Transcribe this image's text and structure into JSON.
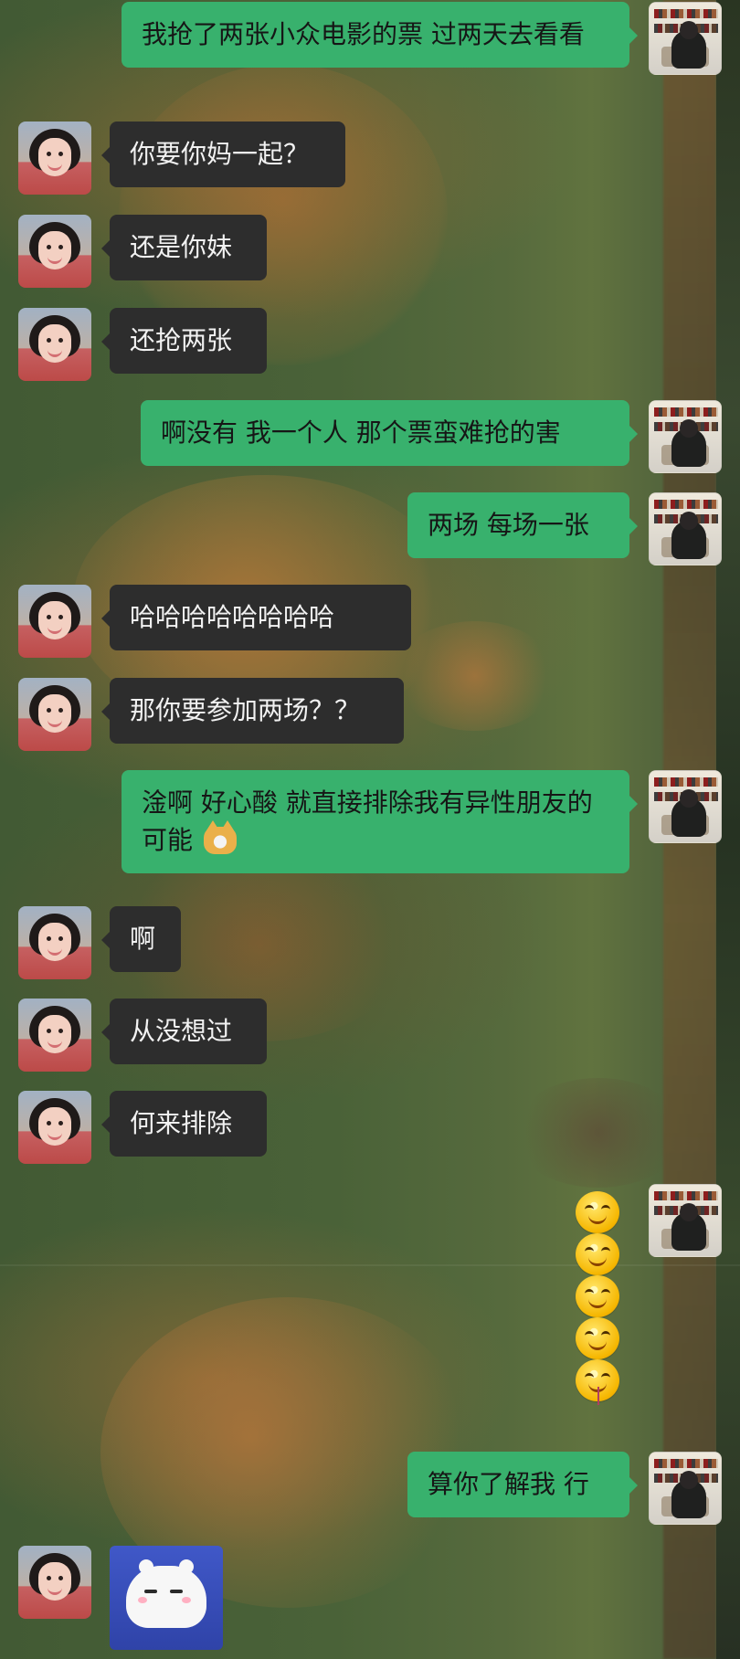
{
  "messages": [
    {
      "side": "right",
      "text": "我抢了两张小众电影的票 过两天去看看"
    },
    {
      "side": "left",
      "text": "你要你妈一起？"
    },
    {
      "side": "left",
      "text": "还是你妹"
    },
    {
      "side": "left",
      "text": "还抢两张"
    },
    {
      "side": "right",
      "text": "啊没有 我一个人 那个票蛮难抢的害"
    },
    {
      "side": "right",
      "text": "两场 每场一张"
    },
    {
      "side": "left",
      "text": "哈哈哈哈哈哈哈哈"
    },
    {
      "side": "left",
      "text": "那你要参加两场？？"
    },
    {
      "side": "right",
      "text": "淦啊 好心酸 就直接排除我有异性朋友的可能"
    },
    {
      "side": "left",
      "text": "啊"
    },
    {
      "side": "left",
      "text": "从没想过"
    },
    {
      "side": "left",
      "text": "何来排除"
    },
    {
      "side": "right",
      "text": "算你了解我 行"
    }
  ],
  "emojis": {
    "cat_icon": "shiba-cat-face",
    "stack_icon": "smiley-face-stack",
    "sticker_icon": "white-bunny-sticker"
  },
  "colors": {
    "incoming_bubble": "#2d2d2d",
    "outgoing_bubble": "#38b16d",
    "incoming_text": "#f2f2f2",
    "outgoing_text": "#161616"
  }
}
